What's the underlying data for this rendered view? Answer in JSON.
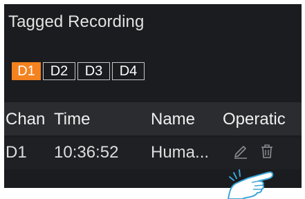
{
  "title": "Tagged Recording",
  "tabs": [
    {
      "label": "D1",
      "active": true
    },
    {
      "label": "D2",
      "active": false
    },
    {
      "label": "D3",
      "active": false
    },
    {
      "label": "D4",
      "active": false
    }
  ],
  "columns": {
    "chan": "Chan",
    "time": "Time",
    "name": "Name",
    "operation": "Operatic"
  },
  "rows": [
    {
      "chan": "D1",
      "time": "10:36:52",
      "name": "Huma...",
      "actions": [
        "edit-icon",
        "delete-icon"
      ]
    }
  ],
  "colors": {
    "accent": "#f4821f",
    "panel": "#1b1c20",
    "header": "#2b2c30"
  }
}
